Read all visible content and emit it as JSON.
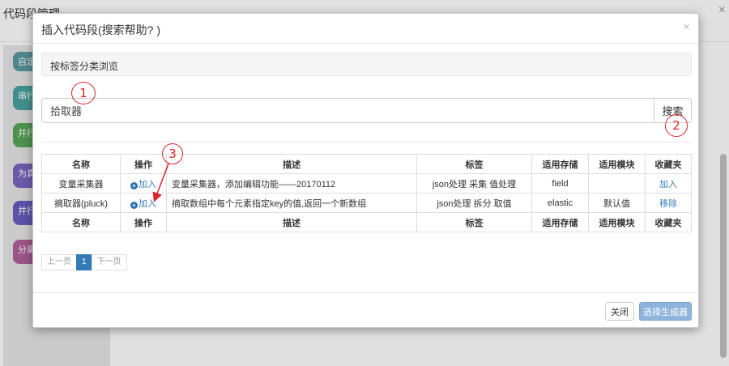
{
  "background": {
    "page_title": "代码段管理",
    "close_icon": "×",
    "blocks": [
      {
        "label": "自定",
        "color": "#5b9aa0"
      },
      {
        "label": "串行",
        "color": "#4aa3a0"
      },
      {
        "label": "并行",
        "color": "#5ba55b"
      },
      {
        "label": "为真",
        "color": "#7a65c0"
      },
      {
        "label": "并行",
        "color": "#6a5dbf"
      },
      {
        "label": "分离",
        "color": "#b0609a"
      }
    ]
  },
  "modal": {
    "title": "插入代码段(搜索帮助? )",
    "close_icon": "×",
    "browse_label": "按标签分类浏览",
    "search": {
      "value": "拾取器",
      "button": "搜索"
    },
    "table": {
      "headers": [
        "名称",
        "操作",
        "描述",
        "标签",
        "适用存储",
        "适用模块",
        "收藏夹"
      ],
      "rows": [
        {
          "name": "变量采集器",
          "action": "加入",
          "desc": "变量采集器，添加编辑功能——20170112",
          "tags": "json处理 采集 值处理",
          "storage": "field",
          "module": "",
          "fav": "加入"
        },
        {
          "name": "摘取器(pluck)",
          "action": "加入",
          "desc": "摘取数组中每个元素指定key的值,返回一个新数组",
          "tags": "json处理 拆分 取值",
          "storage": "elastic",
          "module": "默认值",
          "fav": "移除"
        }
      ]
    },
    "pager": {
      "prev": "上一页",
      "current": "1",
      "next": "下一页"
    },
    "footer": {
      "close": "关闭",
      "select": "选择生成器"
    }
  },
  "annotations": [
    "1",
    "2",
    "3"
  ]
}
